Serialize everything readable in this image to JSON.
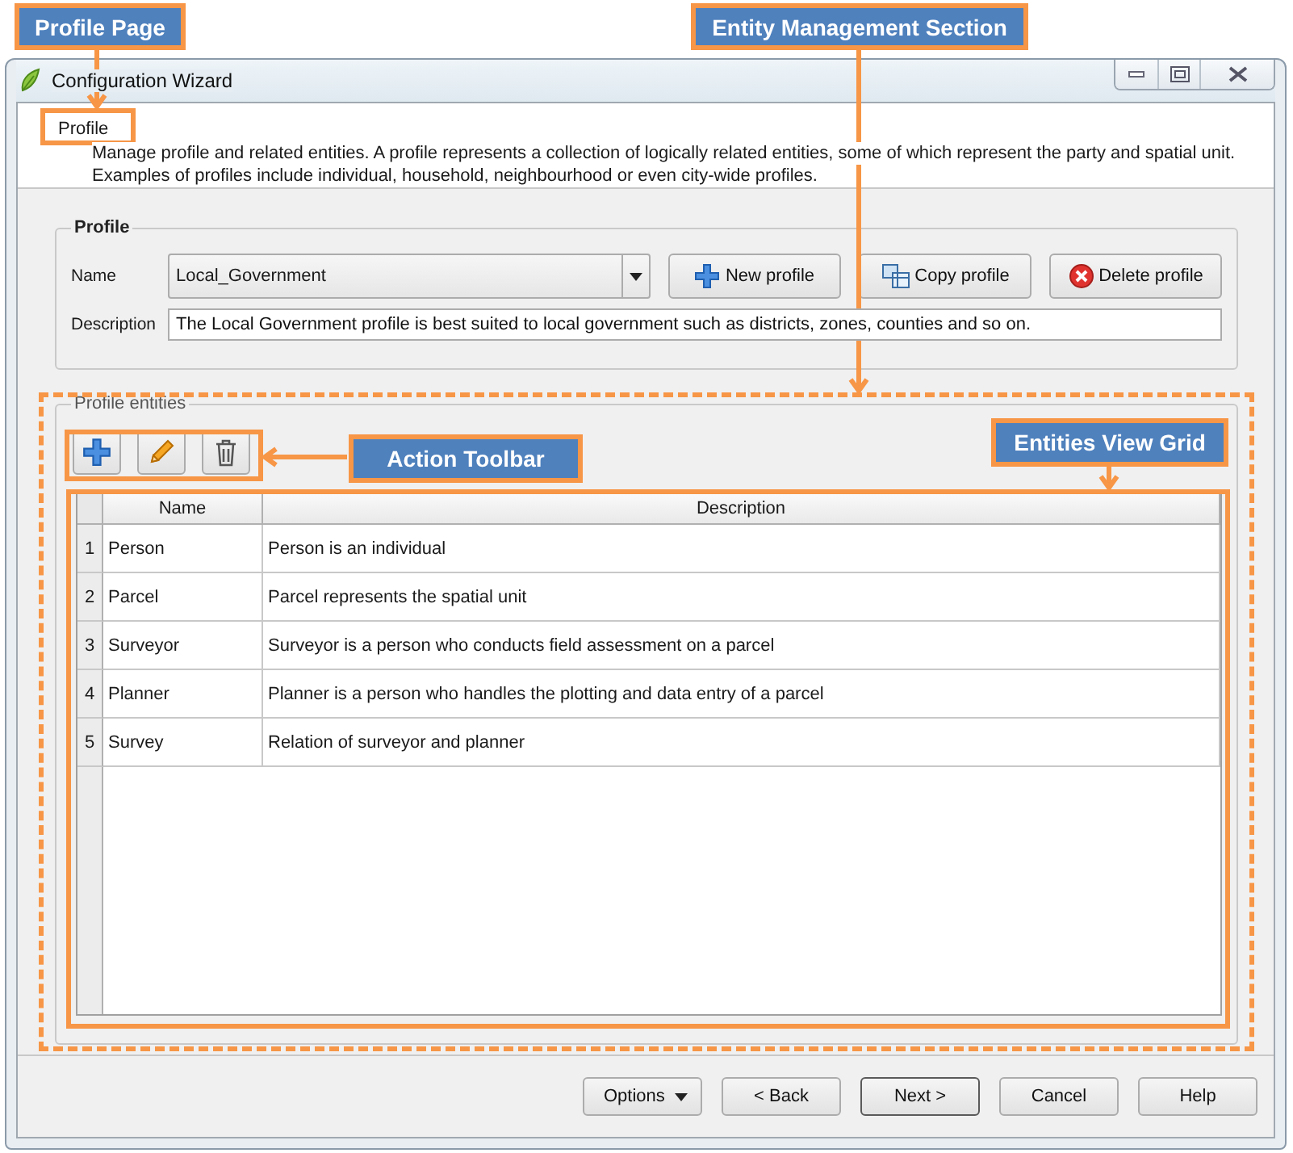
{
  "callouts": [
    {
      "label": "Profile Page"
    },
    {
      "label": "Entity Management Section"
    },
    {
      "label": "Action Toolbar"
    },
    {
      "label": "Entities View Grid"
    }
  ],
  "window": {
    "title": "Configuration Wizard"
  },
  "page": {
    "title": "Profile",
    "description_lines": [
      "Manage profile and related entities.  A profile represents a collection of logically related entities, some of which represent the party and spatial unit.",
      "Examples of profiles include individual, household, neighbourhood or even city-wide profiles."
    ]
  },
  "profile_group": {
    "title": "Profile",
    "name_label": "Name",
    "name_value": "Local_Government",
    "description_label": "Description",
    "description_value": "The Local Government profile is best suited to local government such as districts, zones, counties and so on.",
    "buttons": [
      {
        "label": "New profile",
        "kind": "new"
      },
      {
        "label": "Copy profile",
        "kind": "copy"
      },
      {
        "label": "Delete profile",
        "kind": "delete"
      }
    ]
  },
  "entities_group": {
    "title": "Profile entities",
    "toolbar": [
      {
        "kind": "add"
      },
      {
        "kind": "edit"
      },
      {
        "kind": "delete"
      }
    ],
    "table": {
      "columns": [
        "Name",
        "Description"
      ],
      "rows": [
        {
          "number": "1",
          "name": "Person",
          "description": "Person is an individual"
        },
        {
          "number": "2",
          "name": "Parcel",
          "description": "Parcel represents the spatial unit"
        },
        {
          "number": "3",
          "name": "Surveyor",
          "description": "Surveyor is a person who conducts field assessment on a parcel"
        },
        {
          "number": "4",
          "name": "Planner",
          "description": "Planner is a person who handles the plotting and data entry of a parcel"
        },
        {
          "number": "5",
          "name": "Survey",
          "description": "Relation of surveyor and planner"
        }
      ]
    }
  },
  "footer_buttons": [
    {
      "label": "Options",
      "kind": "menu",
      "default": false
    },
    {
      "label": "< Back",
      "kind": "plain",
      "default": false
    },
    {
      "label": "Next >",
      "kind": "plain",
      "default": true
    },
    {
      "label": "Cancel",
      "kind": "plain",
      "default": false
    },
    {
      "label": "Help",
      "kind": "plain",
      "default": false
    }
  ]
}
